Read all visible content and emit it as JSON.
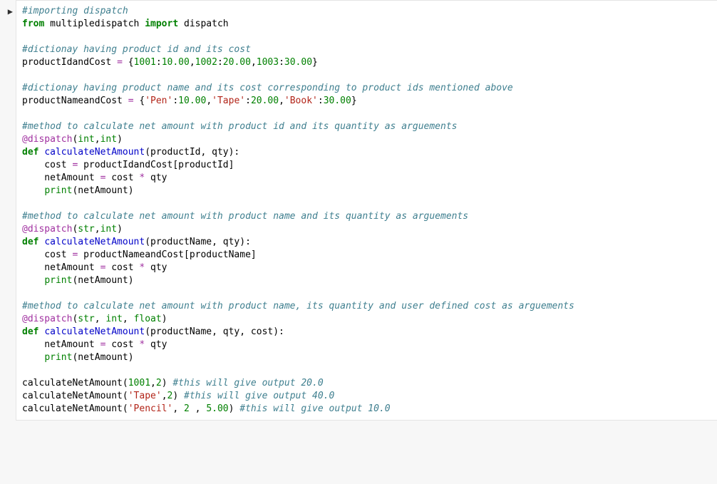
{
  "prompt_icon": "▶",
  "tokens": [
    [
      [
        "c",
        "#importing dispatch"
      ]
    ],
    [
      [
        "kw",
        "from"
      ],
      [
        "nm",
        " multipledispatch "
      ],
      [
        "kw",
        "import"
      ],
      [
        "nm",
        " dispatch"
      ]
    ],
    [],
    [
      [
        "c",
        "#dictionay having product id and its cost"
      ]
    ],
    [
      [
        "nm",
        "productIdandCost "
      ],
      [
        "op",
        "="
      ],
      [
        "nm",
        " {"
      ],
      [
        "num",
        "1001"
      ],
      [
        "nm",
        ":"
      ],
      [
        "num",
        "10.00"
      ],
      [
        "nm",
        ","
      ],
      [
        "num",
        "1002"
      ],
      [
        "nm",
        ":"
      ],
      [
        "num",
        "20.00"
      ],
      [
        "nm",
        ","
      ],
      [
        "num",
        "1003"
      ],
      [
        "nm",
        ":"
      ],
      [
        "num",
        "30.00"
      ],
      [
        "nm",
        "}"
      ]
    ],
    [],
    [
      [
        "c",
        "#dictionay having product name and its cost corresponding to product ids mentioned above"
      ]
    ],
    [
      [
        "nm",
        "productNameandCost "
      ],
      [
        "op",
        "="
      ],
      [
        "nm",
        " {"
      ],
      [
        "str",
        "'Pen'"
      ],
      [
        "nm",
        ":"
      ],
      [
        "num",
        "10.00"
      ],
      [
        "nm",
        ","
      ],
      [
        "str",
        "'Tape'"
      ],
      [
        "nm",
        ":"
      ],
      [
        "num",
        "20.00"
      ],
      [
        "nm",
        ","
      ],
      [
        "str",
        "'Book'"
      ],
      [
        "nm",
        ":"
      ],
      [
        "num",
        "30.00"
      ],
      [
        "nm",
        "}"
      ]
    ],
    [],
    [
      [
        "c",
        "#method to calculate net amount with product id and its quantity as arguements"
      ]
    ],
    [
      [
        "dec",
        "@dispatch"
      ],
      [
        "nm",
        "("
      ],
      [
        "bi",
        "int"
      ],
      [
        "nm",
        ","
      ],
      [
        "bi",
        "int"
      ],
      [
        "nm",
        ")"
      ]
    ],
    [
      [
        "kw",
        "def"
      ],
      [
        "nm",
        " "
      ],
      [
        "fn",
        "calculateNetAmount"
      ],
      [
        "nm",
        "(productId, qty):"
      ]
    ],
    [
      [
        "nm",
        "    cost "
      ],
      [
        "op",
        "="
      ],
      [
        "nm",
        " productIdandCost[productId]"
      ]
    ],
    [
      [
        "nm",
        "    netAmount "
      ],
      [
        "op",
        "="
      ],
      [
        "nm",
        " cost "
      ],
      [
        "op",
        "*"
      ],
      [
        "nm",
        " qty"
      ]
    ],
    [
      [
        "nm",
        "    "
      ],
      [
        "bi",
        "print"
      ],
      [
        "nm",
        "(netAmount)"
      ]
    ],
    [],
    [
      [
        "c",
        "#method to calculate net amount with product name and its quantity as arguements"
      ]
    ],
    [
      [
        "dec",
        "@dispatch"
      ],
      [
        "nm",
        "("
      ],
      [
        "bi",
        "str"
      ],
      [
        "nm",
        ","
      ],
      [
        "bi",
        "int"
      ],
      [
        "nm",
        ")"
      ]
    ],
    [
      [
        "kw",
        "def"
      ],
      [
        "nm",
        " "
      ],
      [
        "fn",
        "calculateNetAmount"
      ],
      [
        "nm",
        "(productName, qty):"
      ]
    ],
    [
      [
        "nm",
        "    cost "
      ],
      [
        "op",
        "="
      ],
      [
        "nm",
        " productNameandCost[productName]"
      ]
    ],
    [
      [
        "nm",
        "    netAmount "
      ],
      [
        "op",
        "="
      ],
      [
        "nm",
        " cost "
      ],
      [
        "op",
        "*"
      ],
      [
        "nm",
        " qty"
      ]
    ],
    [
      [
        "nm",
        "    "
      ],
      [
        "bi",
        "print"
      ],
      [
        "nm",
        "(netAmount)"
      ]
    ],
    [],
    [
      [
        "c",
        "#method to calculate net amount with product name, its quantity and user defined cost as arguements"
      ]
    ],
    [
      [
        "dec",
        "@dispatch"
      ],
      [
        "nm",
        "("
      ],
      [
        "bi",
        "str"
      ],
      [
        "nm",
        ", "
      ],
      [
        "bi",
        "int"
      ],
      [
        "nm",
        ", "
      ],
      [
        "bi",
        "float"
      ],
      [
        "nm",
        ")"
      ]
    ],
    [
      [
        "kw",
        "def"
      ],
      [
        "nm",
        " "
      ],
      [
        "fn",
        "calculateNetAmount"
      ],
      [
        "nm",
        "(productName, qty, cost):"
      ]
    ],
    [
      [
        "nm",
        "    netAmount "
      ],
      [
        "op",
        "="
      ],
      [
        "nm",
        " cost "
      ],
      [
        "op",
        "*"
      ],
      [
        "nm",
        " qty"
      ]
    ],
    [
      [
        "nm",
        "    "
      ],
      [
        "bi",
        "print"
      ],
      [
        "nm",
        "(netAmount)"
      ]
    ],
    [],
    [
      [
        "nm",
        "calculateNetAmount("
      ],
      [
        "num",
        "1001"
      ],
      [
        "nm",
        ","
      ],
      [
        "num",
        "2"
      ],
      [
        "nm",
        ") "
      ],
      [
        "c",
        "#this will give output 20.0"
      ]
    ],
    [
      [
        "nm",
        "calculateNetAmount("
      ],
      [
        "str",
        "'Tape'"
      ],
      [
        "nm",
        ","
      ],
      [
        "num",
        "2"
      ],
      [
        "nm",
        ") "
      ],
      [
        "c",
        "#this will give output 40.0"
      ]
    ],
    [
      [
        "nm",
        "calculateNetAmount("
      ],
      [
        "str",
        "'Pencil'"
      ],
      [
        "nm",
        ", "
      ],
      [
        "num",
        "2"
      ],
      [
        "nm",
        " , "
      ],
      [
        "num",
        "5.00"
      ],
      [
        "nm",
        ") "
      ],
      [
        "c",
        "#this will give output 10.0"
      ]
    ]
  ]
}
